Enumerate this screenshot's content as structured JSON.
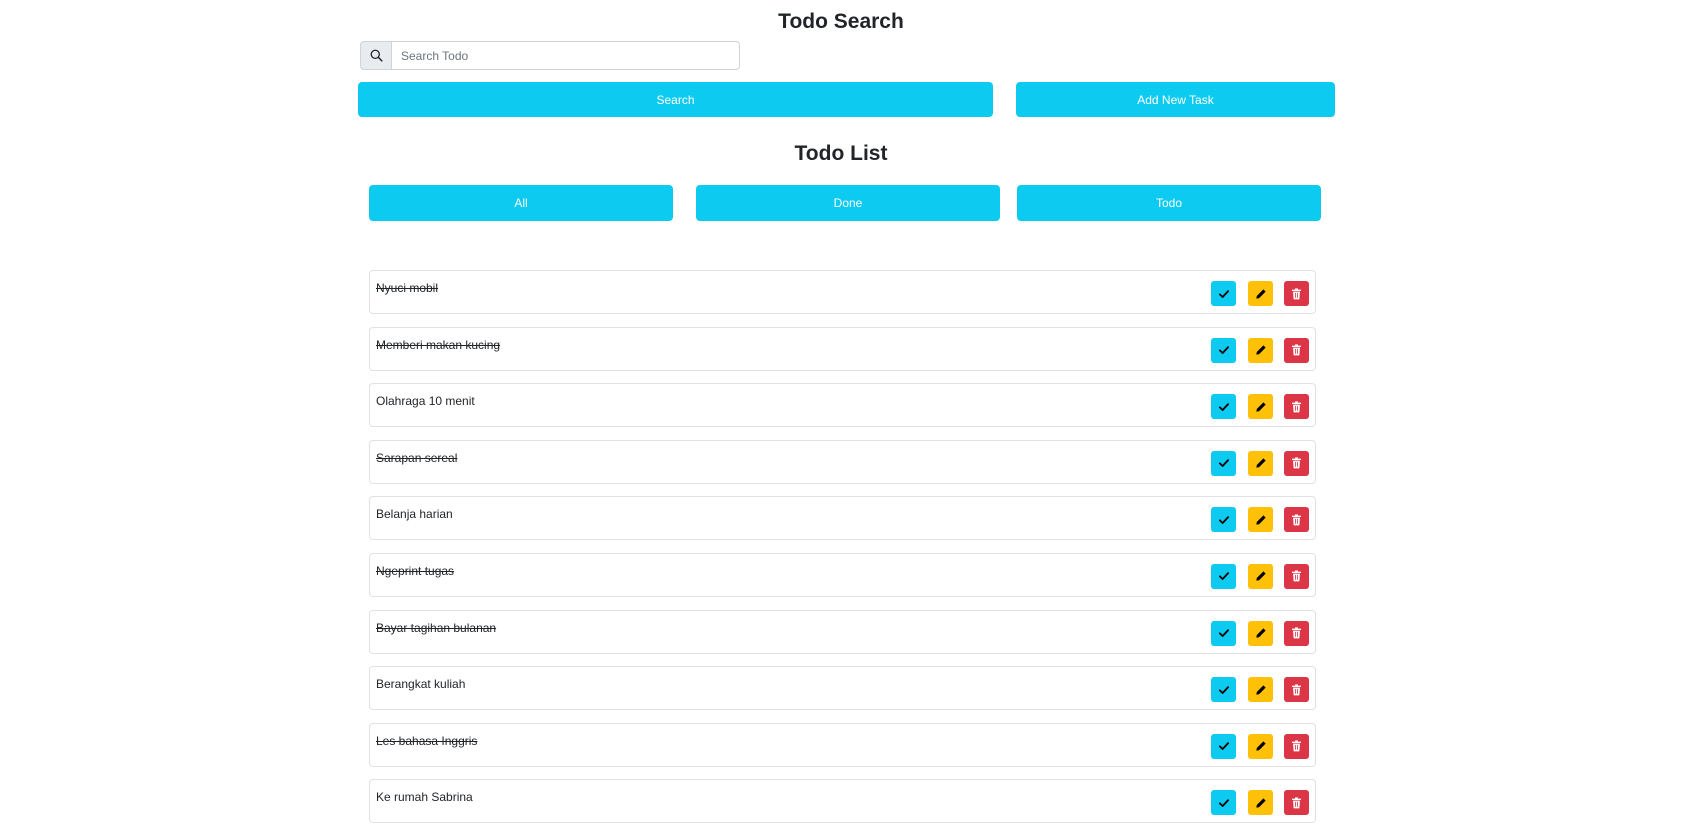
{
  "search": {
    "title": "Todo Search",
    "placeholder": "Search Todo",
    "search_label": "Search",
    "add_label": "Add New Task"
  },
  "list": {
    "title": "Todo List",
    "filters": {
      "all": "All",
      "done": "Done",
      "todo": "Todo"
    },
    "items": [
      {
        "text": "Nyuci mobil",
        "done": true
      },
      {
        "text": "Memberi makan kucing",
        "done": true
      },
      {
        "text": "Olahraga 10 menit",
        "done": false
      },
      {
        "text": "Sarapan sereal",
        "done": true
      },
      {
        "text": "Belanja harian",
        "done": false
      },
      {
        "text": "Ngeprint tugas",
        "done": true
      },
      {
        "text": "Bayar tagihan bulanan",
        "done": true
      },
      {
        "text": "Berangkat kuliah",
        "done": false
      },
      {
        "text": "Les bahasa Inggris",
        "done": true
      },
      {
        "text": "Ke rumah Sabrina",
        "done": false
      }
    ]
  },
  "icons": {
    "search": "search-icon",
    "check": "check-icon",
    "edit": "pencil-icon",
    "delete": "trash-icon"
  },
  "colors": {
    "primary_button": "#0dcaf0",
    "edit_button": "#ffc107",
    "delete_button": "#dc3545"
  }
}
